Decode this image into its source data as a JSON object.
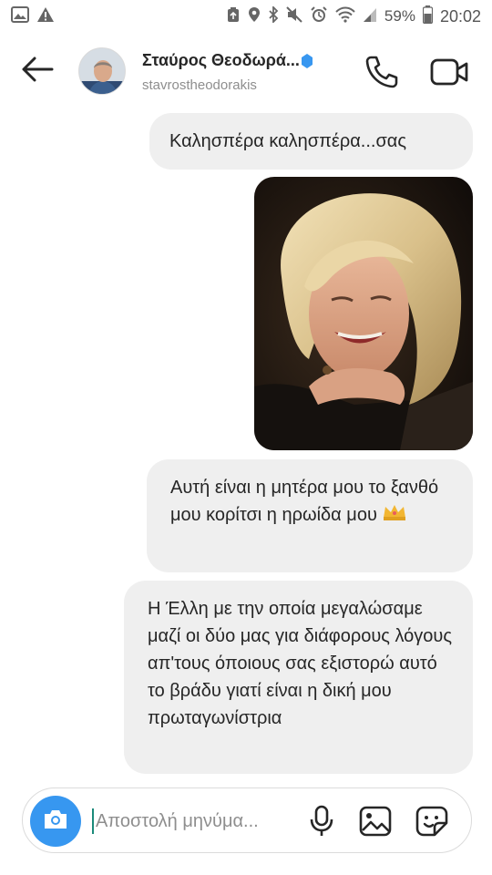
{
  "status_bar": {
    "battery_percent": "59%",
    "time": "20:02",
    "left_icons": [
      "image-notification-icon",
      "warning-icon"
    ],
    "right_icons": [
      "data-saver-icon",
      "location-icon",
      "bluetooth-icon",
      "mute-icon",
      "alarm-icon",
      "wifi-icon",
      "signal-icon",
      "battery-icon"
    ]
  },
  "header": {
    "contact_name": "Σταύρος Θεοδωρά...",
    "handle": "stavrostheodorakis",
    "verified": true
  },
  "messages": {
    "msg1": "Καλησπέρα καλησπέρα...σας",
    "msg2": "Αυτή είναι η μητέρα μου το ξανθό μου κορίτσι η ηρωίδα μου",
    "msg3": "Η Έλλη με την οποία μεγαλώσαμε μαζί οι δύο μας για διάφορους λόγους απ'τους όποιους σας εξιστορώ αυτό το βράδυ γιατί είναι η δική μου πρωταγωνίστρια"
  },
  "composer": {
    "placeholder": "Αποστολή μηνύμα..."
  },
  "colors": {
    "accent_blue": "#3797f0",
    "bubble_bg": "#efefef",
    "verified_blue": "#3897f0",
    "secondary_text": "#8e8e8e"
  }
}
